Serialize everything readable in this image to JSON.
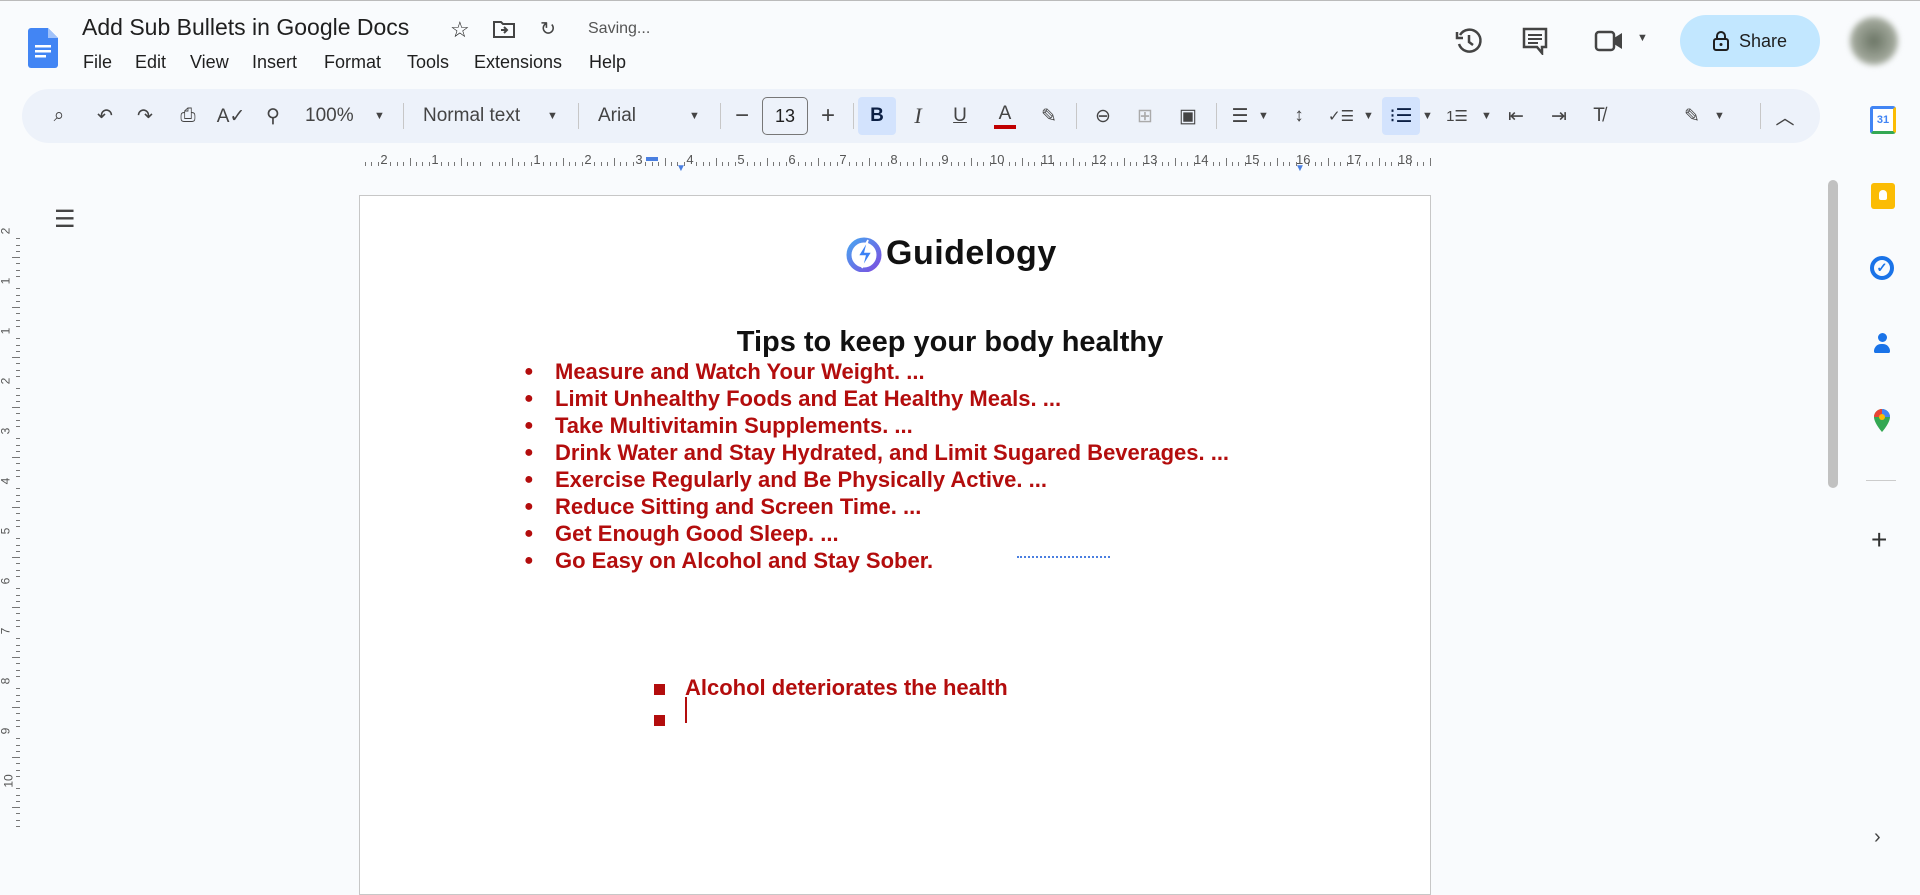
{
  "header": {
    "doc_title": "Add Sub Bullets in Google Docs",
    "status": "Saving...",
    "share_label": "Share"
  },
  "menu": [
    "File",
    "Edit",
    "View",
    "Insert",
    "Format",
    "Tools",
    "Extensions",
    "Help"
  ],
  "toolbar": {
    "zoom": "100%",
    "style": "Normal text",
    "font": "Arial",
    "font_size": "13",
    "text_color": "#c00000",
    "bold_active": true,
    "bulleted_list_active": true
  },
  "ruler": {
    "labels": [
      "2",
      "1",
      "1",
      "2",
      "3",
      "4",
      "5",
      "6",
      "7",
      "8",
      "9",
      "10",
      "11",
      "12",
      "13",
      "14",
      "15",
      "16",
      "17",
      "18"
    ]
  },
  "vruler": {
    "labels": [
      "2",
      "1",
      "1",
      "2",
      "3",
      "4",
      "5",
      "6",
      "7",
      "8",
      "9",
      "10"
    ]
  },
  "document": {
    "logo_text": "Guidelogy",
    "heading": "Tips to keep your body healthy",
    "bullets": [
      "Measure and Watch Your Weight. ...",
      "Limit Unhealthy Foods and Eat Healthy Meals. ...",
      "Take Multivitamin Supplements. ...",
      "Drink Water and Stay Hydrated, and Limit Sugared Beverages. ...",
      "Exercise Regularly and Be Physically Active. ...",
      "Reduce Sitting and Screen Time. ...",
      "Get Enough Good Sleep. ...",
      "Go Easy on Alcohol and Stay Sober."
    ],
    "sub_bullets": [
      "Alcohol deteriorates the health",
      ""
    ],
    "text_color": "#b30d0d"
  },
  "side_panel": {
    "calendar_day": "31",
    "icons": [
      "calendar-icon",
      "keep-icon",
      "tasks-icon",
      "contacts-icon",
      "maps-icon",
      "add-icon",
      "expand-icon"
    ]
  }
}
